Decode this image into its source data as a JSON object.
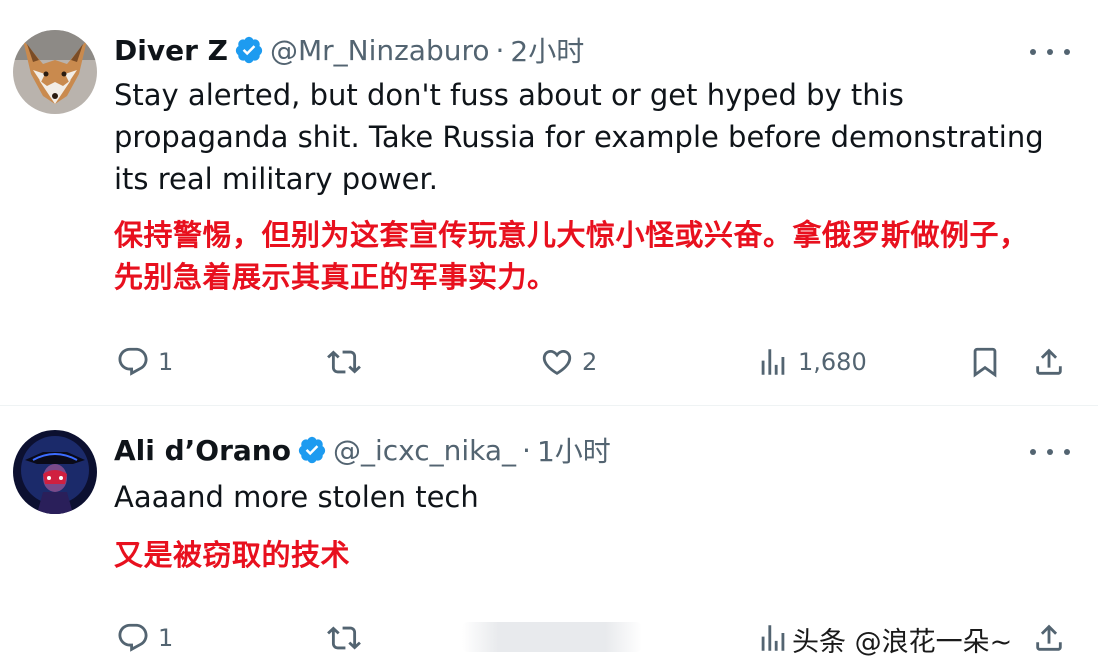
{
  "tweets": [
    {
      "display_name": "Diver Z",
      "handle": "@Mr_Ninzaburo",
      "dot": "·",
      "time": "2小时",
      "text": "Stay alerted, but don't fuss about or get hyped by this propaganda shit. Take Russia for example before demonstrating its real military power.",
      "translation": "保持警惕，但别为这套宣传玩意儿大惊小怪或兴奋。拿俄罗斯做例子，先别急着展示其真正的军事实力。",
      "avatar_icon": "fox-avatar",
      "stats": {
        "replies": "1",
        "retweets": "",
        "likes": "2",
        "views": "1,680"
      }
    },
    {
      "display_name": "Ali d’Orano",
      "handle": "@_icxc_nika_",
      "dot": "·",
      "time": "1小时",
      "text": "Aaaand more stolen tech",
      "translation": "又是被窃取的技术",
      "avatar_icon": "dark-figure-avatar",
      "stats": {
        "replies": "1",
        "retweets": "",
        "likes": "",
        "views": ""
      }
    }
  ],
  "watermark": "头条 @浪花一朵~",
  "colors": {
    "verified": "#1d9bf0",
    "translation": "#e8101e",
    "secondary_text": "#536471",
    "primary_text": "#0f1419",
    "divider": "#eff3f4"
  }
}
